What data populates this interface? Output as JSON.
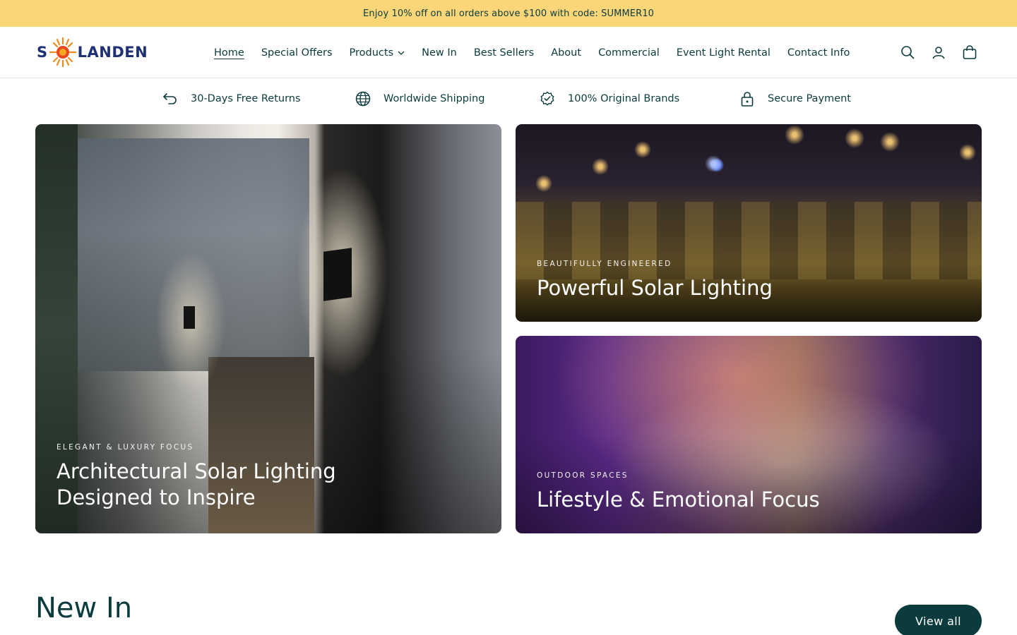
{
  "announcement": "Enjoy 10% off on all orders above $100 with code: SUMMER10",
  "brand": {
    "logo_left": "S",
    "logo_right": "LANDEN"
  },
  "nav": {
    "items": [
      {
        "label": "Home"
      },
      {
        "label": "Special Offers"
      },
      {
        "label": "Products"
      },
      {
        "label": "New In"
      },
      {
        "label": "Best Sellers"
      },
      {
        "label": "About"
      },
      {
        "label": "Commercial"
      },
      {
        "label": "Event Light Rental"
      },
      {
        "label": "Contact Info"
      }
    ]
  },
  "header_icons": [
    "search-icon",
    "account-icon",
    "cart-icon"
  ],
  "features": [
    {
      "label": "30-Days Free Returns",
      "icon": "return-arrow-icon"
    },
    {
      "label": "Worldwide Shipping",
      "icon": "globe-icon"
    },
    {
      "label": "100% Original Brands",
      "icon": "verified-badge-icon"
    },
    {
      "label": "Secure Payment",
      "icon": "lock-icon"
    }
  ],
  "cards": [
    {
      "kicker": "ELEGANT & LUXURY FOCUS",
      "headline_line1": "Architectural Solar Lighting",
      "headline_line2": "Designed to Inspire"
    },
    {
      "kicker": "BEAUTIFULLY ENGINEERED",
      "headline": "Powerful Solar Lighting"
    },
    {
      "kicker": "OUTDOOR SPACES",
      "headline": "Lifestyle & Emotional Focus"
    }
  ],
  "new_in": {
    "title": "New In",
    "view_all": "View all"
  },
  "colors": {
    "announcement_bg": "#fbd679",
    "primary": "#0b3b3c",
    "logo_blue": "#1f3173",
    "logo_sun": "#f08a1c"
  }
}
